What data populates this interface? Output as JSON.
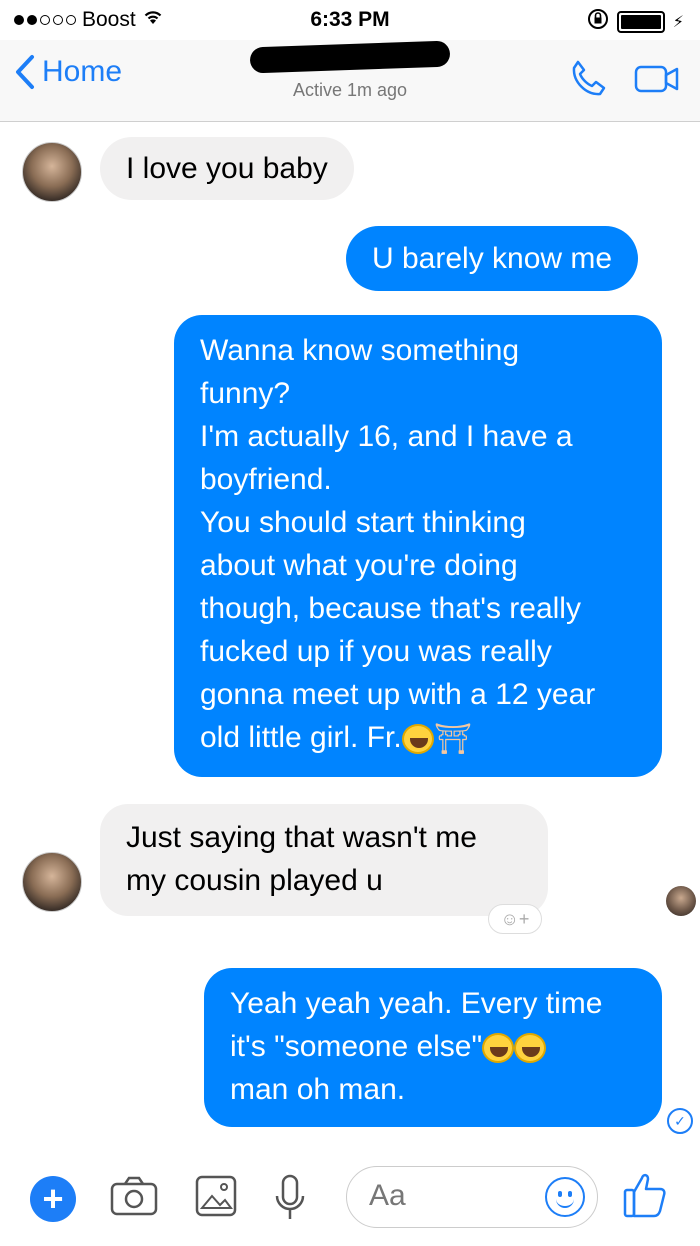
{
  "status_bar": {
    "carrier": "Boost",
    "time": "6:33 PM",
    "signal_dots": [
      "on",
      "on",
      "off",
      "off",
      "off"
    ],
    "battery_level": 1.0
  },
  "header": {
    "back_label": "Home",
    "contact_status": "Active 1m ago"
  },
  "messages": [
    {
      "direction": "incoming",
      "text": "I love you baby"
    },
    {
      "direction": "outgoing",
      "text": "U barely know me"
    },
    {
      "direction": "outgoing",
      "lines": [
        "Wanna know something",
        "funny?",
        "I'm actually 16, and I have a",
        "boyfriend.",
        "You should start thinking",
        "about what you're doing",
        "though, because that's really",
        "fucked up if you was really",
        "gonna meet up with a 12 year",
        "old little girl. Fr."
      ]
    },
    {
      "direction": "incoming",
      "lines": [
        "Just saying that wasn't me",
        "my cousin played u"
      ]
    },
    {
      "direction": "outgoing",
      "lines": [
        "Yeah yeah yeah. Every time",
        "it's \"someone else\"",
        "man oh man."
      ]
    }
  ],
  "composer": {
    "placeholder": "Aa"
  },
  "colors": {
    "accent": "#1d7ef7",
    "outgoing_bubble": "#0084ff",
    "incoming_bubble": "#f1f0f0"
  }
}
